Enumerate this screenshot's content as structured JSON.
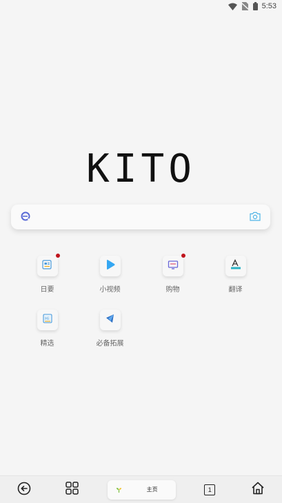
{
  "status_bar": {
    "time": "5:53",
    "icons": [
      "wifi-icon",
      "no-sim-icon",
      "battery-icon"
    ]
  },
  "logo": {
    "text": "KITO"
  },
  "search": {
    "placeholder": "",
    "left_icon": "browser-logo-icon",
    "right_icon": "camera-icon",
    "accent_color": "#5a6bd6",
    "camera_color": "#4db3e6"
  },
  "shortcuts": [
    {
      "label": "日要",
      "icon": "news-icon",
      "badge": true
    },
    {
      "label": "小视频",
      "icon": "play-icon",
      "badge": false
    },
    {
      "label": "购物",
      "icon": "shopping-screen-icon",
      "badge": true
    },
    {
      "label": "翻译",
      "icon": "translate-icon",
      "badge": false
    },
    {
      "label": "精选",
      "icon": "featured-icon",
      "badge": false
    },
    {
      "label": "必备拓展",
      "icon": "extensions-icon",
      "badge": false
    }
  ],
  "bottom_nav": {
    "back_icon": "back-arrow-icon",
    "grid_icon": "grid-icon",
    "home_pill_label": "主页",
    "tab_count": "1",
    "home_icon": "home-icon"
  },
  "colors": {
    "background": "#f5f5f5",
    "badge_red": "#c0151d",
    "play_blue": "#35a7f2",
    "translate_teal": "#2bb2c4"
  }
}
